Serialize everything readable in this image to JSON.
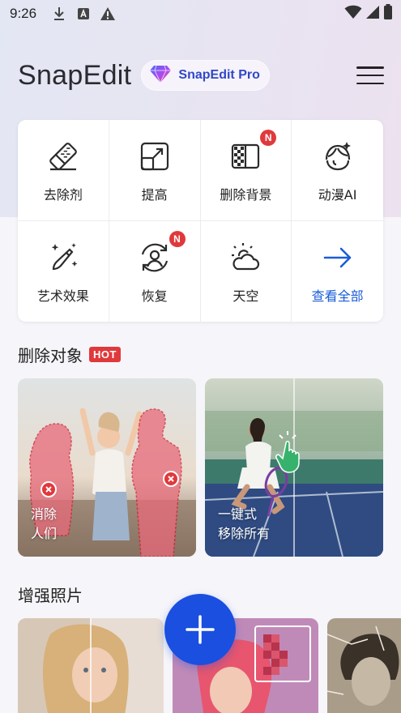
{
  "status_bar": {
    "time": "9:26"
  },
  "header": {
    "app_title": "SnapEdit",
    "pro_label": "SnapEdit Pro"
  },
  "tools": [
    {
      "label": "去除剂",
      "icon": "eraser-icon",
      "badge": ""
    },
    {
      "label": "提高",
      "icon": "enhance-icon",
      "badge": ""
    },
    {
      "label": "删除背景",
      "icon": "remove-background-icon",
      "badge": "N"
    },
    {
      "label": "动漫AI",
      "icon": "anime-face-icon",
      "badge": ""
    },
    {
      "label": "艺术效果",
      "icon": "magic-brush-icon",
      "badge": ""
    },
    {
      "label": "恢复",
      "icon": "restore-face-icon",
      "badge": "N"
    },
    {
      "label": "天空",
      "icon": "sky-weather-icon",
      "badge": ""
    },
    {
      "label": "查看全部",
      "icon": "arrow-right-icon",
      "badge": ""
    }
  ],
  "remove_section": {
    "title": "删除对象",
    "hot_label": "HOT",
    "cards": [
      {
        "caption_line1": "消除",
        "caption_line2": "人们"
      },
      {
        "caption_line1": "一键式",
        "caption_line2": "移除所有"
      }
    ]
  },
  "enhance_section": {
    "title": "增强照片"
  },
  "colors": {
    "accent": "#1a5dd8",
    "fab": "#1a4fe0",
    "badge": "#e0393c"
  }
}
